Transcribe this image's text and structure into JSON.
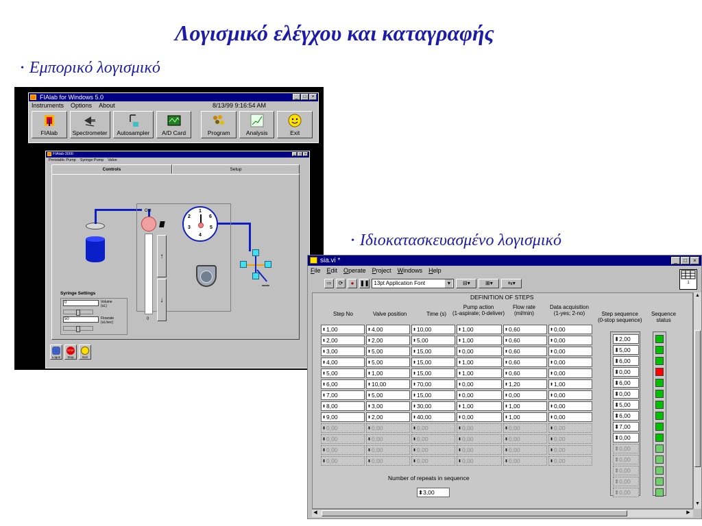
{
  "slide": {
    "title": "Λογισμικό ελέγχου και καταγραφής",
    "bullet_commercial": "Εμπορικό λογισμικό",
    "bullet_custom": "Ιδιοκατασκευασμένο λογισμικό",
    "bullet_glyph": "•"
  },
  "fialab": {
    "title": "FIAlab for Windows 5.0",
    "menu": [
      "Instruments",
      "Options",
      "About"
    ],
    "timestamp": "8/13/99 9:16:54 AM",
    "tools": [
      "FIAlab",
      "Spectrometer",
      "Autosampler",
      "A/D Card",
      "Program",
      "Analysis",
      "Exit"
    ],
    "inner_title": "FIAlab-3000",
    "inner_menu": [
      "Peristaltic Pump",
      "Syringe Pump",
      "Valve"
    ],
    "tab_controls": "Controls",
    "tab_setup": "Setup",
    "out_label": "Out",
    "dial_positions": [
      "1",
      "2",
      "3",
      "4",
      "5",
      "6"
    ],
    "syringe_up": "↑",
    "syringe_down": "↓",
    "syringe_zero": "0",
    "syringe_settings_label": "Syringe Settings",
    "volume_value": "0",
    "volume_label": "Volume",
    "volume_unit": "(uL)",
    "flowrate_value": "50",
    "flowrate_label": "Flowrate",
    "flowrate_unit": "(uL/sec)",
    "valve_label": "waste",
    "bottom_buttons": [
      "Logon",
      "Stop",
      "Exit"
    ],
    "stop_text": "STOP"
  },
  "labview": {
    "title": "sia.vi *",
    "menu": [
      "File",
      "Edit",
      "Operate",
      "Project",
      "Windows",
      "Help"
    ],
    "font_select": "13pt Application Font",
    "vi_icon_value": "1",
    "definition_title": "DEFINITION OF STEPS",
    "columns": [
      "Step No",
      "Valve position",
      "Time (s)",
      "Pump action",
      "(1-aspirate; 0-deliver)",
      "Flow rate",
      "(ml/min)",
      "Data acquisition",
      "(1-yes; 2-no)",
      "Step sequence",
      "(0-stop sequence)",
      "Sequence",
      "status"
    ],
    "rows": [
      [
        "1,00",
        "4,00",
        "10,00",
        "1,00",
        "0,60",
        "0,00"
      ],
      [
        "2,00",
        "2,00",
        "5,00",
        "1,00",
        "0,60",
        "0,00"
      ],
      [
        "3,00",
        "5,00",
        "15,00",
        "0,00",
        "0,60",
        "0,00"
      ],
      [
        "4,00",
        "5,00",
        "15,00",
        "1,00",
        "0,60",
        "0,00"
      ],
      [
        "5,00",
        "1,00",
        "15,00",
        "1,00",
        "0,60",
        "0,00"
      ],
      [
        "6,00",
        "10,00",
        "70,00",
        "0,00",
        "1,20",
        "1,00"
      ],
      [
        "7,00",
        "5,00",
        "15,00",
        "0,00",
        "0,00",
        "0,00"
      ],
      [
        "8,00",
        "3,00",
        "30,00",
        "1,00",
        "1,00",
        "0,00"
      ],
      [
        "9,00",
        "2,00",
        "40,00",
        "0,00",
        "1,00",
        "0,00"
      ]
    ],
    "blank_value": "0,00",
    "blank_rows": 4,
    "sequence": [
      "2,00",
      "5,00",
      "6,00",
      "0,00",
      "6,00",
      "0,00",
      "5,00",
      "6,00",
      "7,00",
      "0,00"
    ],
    "sequence_blanks": 5,
    "status_colors": [
      "#00c000",
      "#00c000",
      "#00c000",
      "#ff0000",
      "#00c000",
      "#00c000",
      "#00c000",
      "#00c000",
      "#00c000",
      "#00c000",
      "#70d070",
      "#70d070",
      "#70d070",
      "#70d070",
      "#70d070"
    ],
    "repeats_label": "Number of repeats in sequence",
    "repeats_value": "3,00"
  }
}
